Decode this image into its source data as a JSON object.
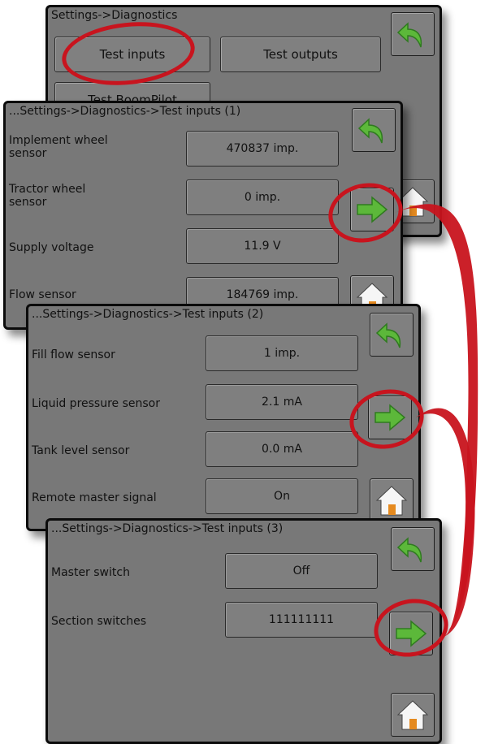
{
  "screen1": {
    "breadcrumb": "Settings->Diagnostics",
    "test_inputs_label": "Test inputs",
    "test_outputs_label": "Test outputs",
    "test_boompilot_label": "Test BoomPilot"
  },
  "screen2": {
    "breadcrumb": "...Settings->Diagnostics->Test inputs (1)",
    "rows": [
      {
        "label": "Implement wheel sensor",
        "value": "470837 imp."
      },
      {
        "label": "Tractor wheel sensor",
        "value": "0 imp."
      },
      {
        "label": "Supply voltage",
        "value": "11.9 V"
      },
      {
        "label": "Flow sensor",
        "value": "184769 imp."
      }
    ]
  },
  "screen3": {
    "breadcrumb": "...Settings->Diagnostics->Test inputs (2)",
    "rows": [
      {
        "label": "Fill flow sensor",
        "value": "1 imp."
      },
      {
        "label": "Liquid pressure sensor",
        "value": "2.1 mA"
      },
      {
        "label": "Tank level sensor",
        "value": "0.0 mA"
      },
      {
        "label": "Remote master signal",
        "value": "On"
      }
    ]
  },
  "screen4": {
    "breadcrumb": "...Settings->Diagnostics->Test inputs (3)",
    "rows": [
      {
        "label": "Master switch",
        "value": "Off"
      },
      {
        "label": "Section switches",
        "value": "111111111"
      }
    ]
  },
  "icons": {
    "back": "back-arrow-icon",
    "next": "next-arrow-icon",
    "home": "home-icon"
  },
  "colors": {
    "panel_bg": "#787878",
    "highlight": "#c8141e",
    "arrow_green": "#5cb83a",
    "home_orange": "#e58a1f"
  }
}
